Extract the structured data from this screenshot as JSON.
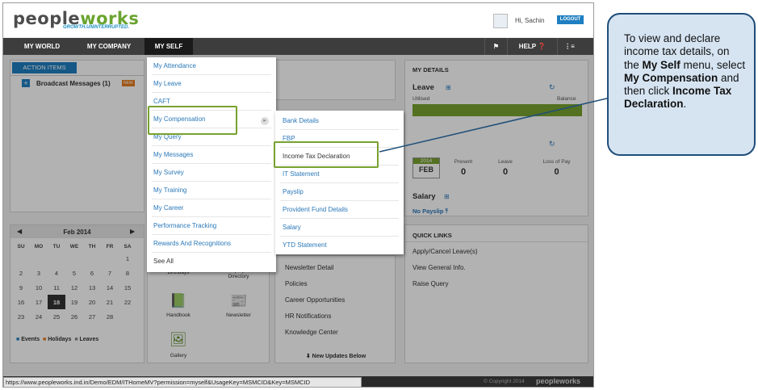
{
  "header": {
    "logo_part1": "people",
    "logo_part2": "works",
    "tagline": "GROWTH.UNINTERRUPTED.",
    "greeting": "Hi, Sachin",
    "logout": "LOGOUT"
  },
  "nav": {
    "tabs": [
      "MY WORLD",
      "MY COMPANY",
      "MY SELF"
    ],
    "help": "HELP"
  },
  "action_items": {
    "tab": "ACTION ITEMS",
    "broadcast": "Broadcast Messages",
    "broadcast_count": "(1)",
    "new_badge": "NEW"
  },
  "self_menu": [
    "My Attendance",
    "My Leave",
    "CAFT",
    "My Compensation",
    "My Query",
    "My Messages",
    "My Survey",
    "My Training",
    "My Career",
    "Performance Tracking",
    "Rewards And Recognitions",
    "See All"
  ],
  "compensation_menu": [
    "Bank Details",
    "FBP",
    "Income Tax Declaration",
    "IT Statement",
    "Payslip",
    "Provident Fund Details",
    "Salary",
    "YTD Statement"
  ],
  "my_details": {
    "title": "MY DETAILS",
    "leave": "Leave",
    "utilised": "Utilised",
    "balance": "Balance",
    "year": "2014",
    "month": "FEB",
    "present_label": "Present",
    "present": "0",
    "leave_label": "Leave",
    "leave_val": "0",
    "lop_label": "Loss of Pay",
    "lop": "0",
    "salary": "Salary",
    "no_payslip": "No Payslip"
  },
  "quick_links": {
    "title": "QUICK LINKS",
    "items": [
      "Apply/Cancel Leave(s)",
      "View General Info.",
      "Raise Query"
    ]
  },
  "calendar": {
    "month": "Feb 2014",
    "days": [
      "SU",
      "MO",
      "TU",
      "WE",
      "TH",
      "FR",
      "SA"
    ],
    "rows": [
      [
        "",
        "",
        "",
        "",
        "",
        "",
        "1"
      ],
      [
        "2",
        "3",
        "4",
        "5",
        "6",
        "7",
        "8"
      ],
      [
        "9",
        "10",
        "11",
        "12",
        "13",
        "14",
        "15"
      ],
      [
        "16",
        "17",
        "18",
        "19",
        "20",
        "21",
        "22"
      ],
      [
        "23",
        "24",
        "25",
        "26",
        "27",
        "28",
        ""
      ]
    ],
    "today": "18",
    "legend_events": "Events",
    "legend_holidays": "Holidays",
    "legend_leaves": "Leaves"
  },
  "icons": {
    "birthdays": "Birthdays",
    "directory": "Employee Directory",
    "handbook": "Handbook",
    "newsletter": "Newsletter",
    "gallery": "Gallery"
  },
  "news": {
    "items": [
      "Newsletter Detail",
      "Policies",
      "Career Opportunities",
      "HR Notifications",
      "Knowledge Center"
    ],
    "updates": "New Updates Below"
  },
  "status_url": "https://www.peopleworks.ind.in/Demo/EDM/ITHomeMV?permission=myself&UsageKey=MSMCID&Key=MSMCID",
  "footer": {
    "copyright": "© Copyright 2014",
    "brand": "peopleworks"
  },
  "callout": {
    "t1": "To view and declare income tax details, on the ",
    "b1": "My Self",
    "t2": " menu, select ",
    "b2": "My Compensation",
    "t3": " and then click ",
    "b3": "Income Tax Declaration",
    "t4": "."
  },
  "colors": {
    "accent": "#1f7fc1",
    "green": "#77a22f",
    "nav": "#3d3d3d"
  }
}
